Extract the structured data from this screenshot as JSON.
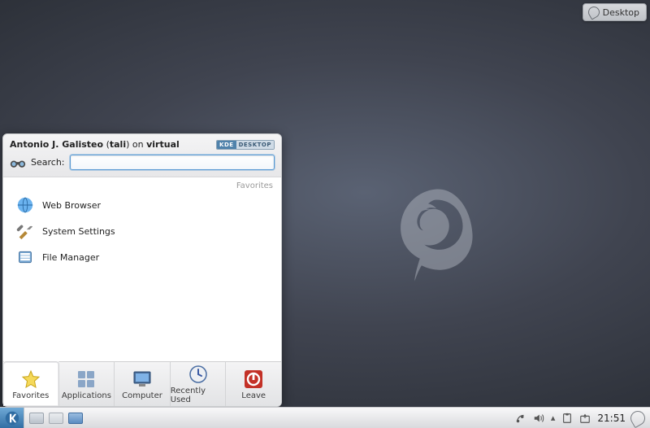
{
  "desktop_toolbox": {
    "label": "Desktop"
  },
  "kickoff": {
    "user_full": "Antonio J. Galisteo",
    "user_short": "tali",
    "host": "virtual",
    "host_prefix": " on ",
    "brand_left": "KDE",
    "brand_right": "DESKTOP",
    "search_label": "Search:",
    "search_value": "",
    "section_title": "Favorites",
    "favorites": [
      {
        "label": "Web Browser",
        "icon": "globe-icon"
      },
      {
        "label": "System Settings",
        "icon": "tools-icon"
      },
      {
        "label": "File Manager",
        "icon": "drive-icon"
      }
    ],
    "tabs": [
      {
        "label": "Favorites",
        "icon": "star-icon",
        "active": true
      },
      {
        "label": "Applications",
        "icon": "apps-icon",
        "active": false
      },
      {
        "label": "Computer",
        "icon": "computer-icon",
        "active": false
      },
      {
        "label": "Recently Used",
        "icon": "clock-icon",
        "active": false
      },
      {
        "label": "Leave",
        "icon": "power-icon",
        "active": false
      }
    ]
  },
  "panel": {
    "clock": "21:51",
    "tasks": [
      "pager",
      "desktop-grid",
      "konqueror"
    ]
  }
}
